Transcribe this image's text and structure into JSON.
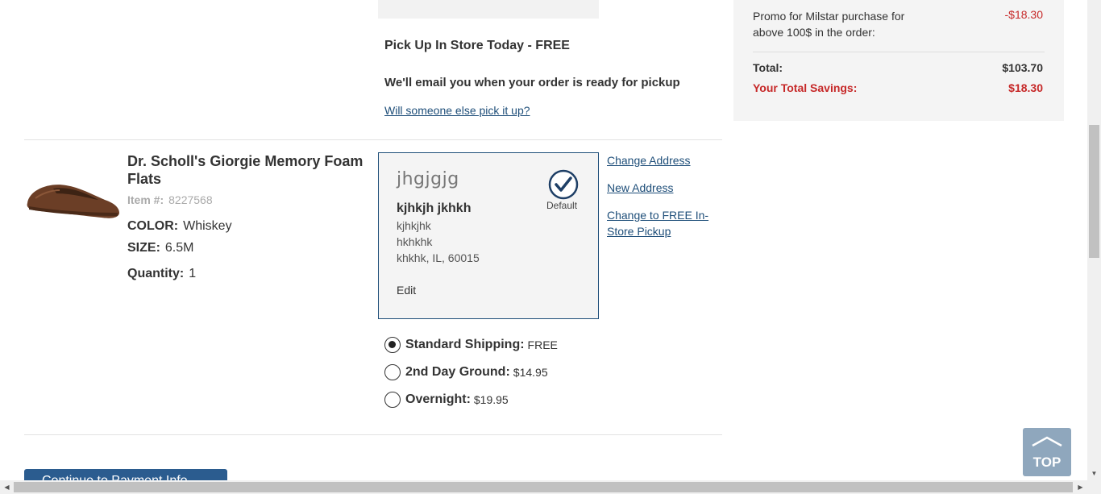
{
  "pickup": {
    "title": "Pick Up In Store Today - FREE",
    "email_note": "We'll email you when your order is ready for pickup",
    "someone_else_link": "Will someone else pick it up?"
  },
  "product": {
    "name": "Dr. Scholl's Giorgie Memory Foam Flats",
    "item_label": "Item #:",
    "item_number": "8227568",
    "color_label": "COLOR:",
    "color_value": "Whiskey",
    "size_label": "SIZE:",
    "size_value": "6.5M",
    "quantity_label": "Quantity:",
    "quantity_value": "1"
  },
  "address": {
    "nickname": "jhgjgjg",
    "name": "kjhkjh jkhkh",
    "line1": "kjhkjhk",
    "line2": "hkhkhk",
    "city_state_zip": "khkhk, IL, 60015",
    "edit_label": "Edit",
    "default_label": "Default"
  },
  "address_actions": {
    "change": "Change Address",
    "new": "New Address",
    "store_pickup": "Change to FREE In-Store Pickup"
  },
  "shipping": {
    "options": [
      {
        "label": "Standard Shipping:",
        "price": "FREE",
        "selected": true
      },
      {
        "label": "2nd Day Ground:",
        "price": "$14.95",
        "selected": false
      },
      {
        "label": "Overnight:",
        "price": "$19.95",
        "selected": false
      }
    ]
  },
  "continue_button": {
    "label": "Continue to Payment Info"
  },
  "summary": {
    "promo_label": "Promo for Milstar purchase for above 100$ in the order:",
    "promo_value": "-$18.30",
    "total_label": "Total:",
    "total_value": "$103.70",
    "savings_label": "Your Total Savings:",
    "savings_value": "$18.30"
  },
  "top_button": {
    "label": "TOP"
  },
  "colors": {
    "link": "#1e4e79",
    "savings_red": "#c62828",
    "primary_button": "#2b5c8f",
    "top_button": "#8fa7bd"
  }
}
